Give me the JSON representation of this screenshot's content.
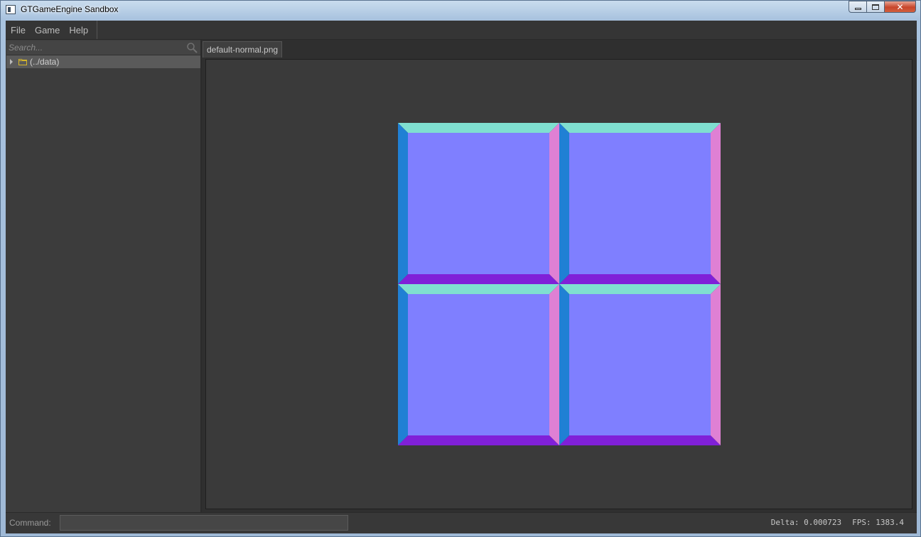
{
  "window": {
    "title": "GTGameEngine Sandbox",
    "caption_buttons": [
      "minimize",
      "maximize",
      "close"
    ],
    "close_glyph": "✕"
  },
  "menubar": {
    "items": [
      "File",
      "Game",
      "Help"
    ]
  },
  "explorer": {
    "search_placeholder": "Search...",
    "tree": [
      {
        "label": "(../data)",
        "icon": "folder-icon",
        "expanded": false
      }
    ]
  },
  "editor": {
    "tabs": [
      {
        "label": "default-normal.png",
        "active": true
      }
    ],
    "image_colors": {
      "face": "#7f7fff",
      "top_bevel": "#7fdfd0",
      "bottom_bevel": "#8020d8",
      "left_bevel": "#2080d4",
      "right_bevel": "#df80d4"
    }
  },
  "statusbar": {
    "command_label": "Command:",
    "command_value": "",
    "delta_label": "Delta:",
    "delta_value": "0.000723",
    "fps_label": "FPS:",
    "fps_value": "1383.4"
  }
}
